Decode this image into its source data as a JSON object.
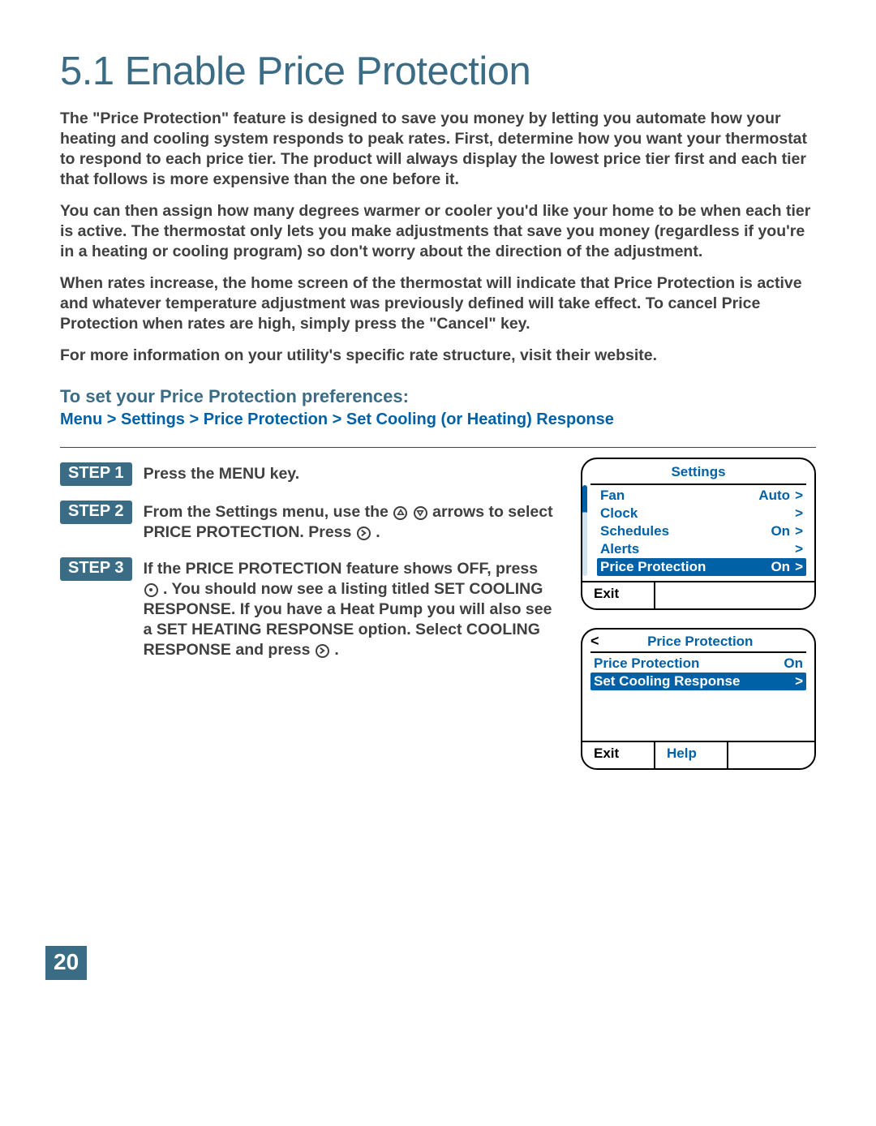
{
  "page_number": "20",
  "heading": "5.1 Enable Price Protection",
  "paragraphs": [
    "The \"Price Protection\" feature is designed to save you money by letting you automate how your heating and cooling system responds to peak rates. First, determine how you want your thermostat to respond to each price tier. The product will always display the lowest price tier first and each tier that follows is more expensive than the one before it.",
    "You can then assign how many degrees warmer or cooler you'd like your home to be when each tier is active. The thermostat only lets you make adjustments that save you money (regardless if you're in a heating or cooling program) so don't worry about the direction of the adjustment.",
    "When rates increase, the home screen of the thermostat will indicate that Price Protection is active and whatever temperature adjustment was previously defined will take effect. To cancel Price Protection when rates are high, simply press the \"Cancel\" key.",
    "For more information on your utility's specific rate structure, visit their website."
  ],
  "subhead": "To set your Price Protection preferences:",
  "navpath": "Menu > Settings > Price Protection > Set Cooling (or Heating) Response",
  "steps": [
    {
      "badge": "STEP 1",
      "text_before": "Press the MENU key."
    },
    {
      "badge": "STEP 2",
      "seg1": "From the Settings menu, use the ",
      "seg2": " arrows to select PRICE PROTECTION. Press ",
      "seg3": " ."
    },
    {
      "badge": "STEP 3",
      "seg1": "If the PRICE PROTECTION feature shows OFF, press ",
      "seg2": ". You should now see a listing titled SET COOLING RESPONSE. If you have a Heat Pump you will also see a SET HEATING RESPONSE option. Select COOLING RESPONSE and press ",
      "seg3": " ."
    }
  ],
  "screen1": {
    "title": "Settings",
    "rows": [
      {
        "label": "Fan",
        "value": "Auto",
        "chev": ">"
      },
      {
        "label": "Clock",
        "value": "",
        "chev": ">"
      },
      {
        "label": "Schedules",
        "value": "On",
        "chev": ">"
      },
      {
        "label": "Alerts",
        "value": "",
        "chev": ">"
      },
      {
        "label": "Price Protection",
        "value": "On",
        "chev": ">",
        "highlight": true
      }
    ],
    "exit": "Exit"
  },
  "screen2": {
    "back": "<",
    "title": "Price Protection",
    "rows": [
      {
        "label": "Price Protection",
        "value": "On",
        "chev": ""
      },
      {
        "label": "Set Cooling Response",
        "value": "",
        "chev": ">",
        "highlight": true
      }
    ],
    "exit": "Exit",
    "help": "Help"
  }
}
